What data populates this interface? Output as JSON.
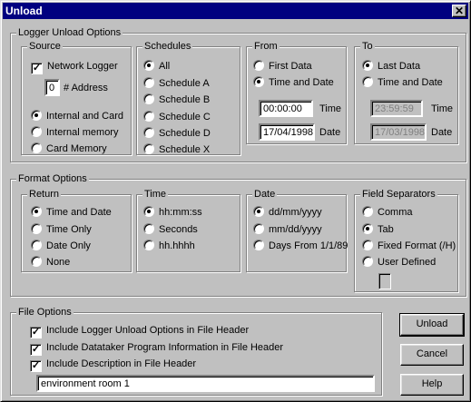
{
  "window": {
    "title": "Unload",
    "close_glyph": "✕"
  },
  "logger_unload": {
    "legend": "Logger Unload Options",
    "source": {
      "legend": "Source",
      "network_logger": "Network Logger",
      "address_value": "0",
      "address_label": "# Address",
      "options": [
        "Internal and Card",
        "Internal memory",
        "Card Memory"
      ]
    },
    "schedules": {
      "legend": "Schedules",
      "options": [
        "All",
        "Schedule A",
        "Schedule B",
        "Schedule C",
        "Schedule D",
        "Schedule X"
      ]
    },
    "from": {
      "legend": "From",
      "options": [
        "First Data",
        "Time and Date"
      ],
      "time_value": "00:00:00",
      "time_label": "Time",
      "date_value": "17/04/1998",
      "date_label": "Date"
    },
    "to": {
      "legend": "To",
      "options": [
        "Last Data",
        "Time and Date"
      ],
      "time_value": "23:59:59",
      "time_label": "Time",
      "date_value": "17/03/1998",
      "date_label": "Date"
    }
  },
  "format": {
    "legend": "Format Options",
    "return": {
      "legend": "Return",
      "options": [
        "Time and Date",
        "Time Only",
        "Date Only",
        "None"
      ]
    },
    "time": {
      "legend": "Time",
      "options": [
        "hh:mm:ss",
        "Seconds",
        "hh.hhhh"
      ]
    },
    "date": {
      "legend": "Date",
      "options": [
        "dd/mm/yyyy",
        "mm/dd/yyyy",
        "Days From 1/1/89"
      ]
    },
    "separators": {
      "legend": "Field Separators",
      "options": [
        "Comma",
        "Tab",
        "Fixed Format (/H)",
        "User Defined"
      ]
    }
  },
  "file": {
    "legend": "File Options",
    "options": [
      "Include Logger Unload Options in File Header",
      "Include Datataker Program Information in File Header",
      "Include Description in File Header"
    ],
    "description_value": "environment room 1"
  },
  "buttons": {
    "unload": "Unload",
    "cancel": "Cancel",
    "help": "Help"
  }
}
